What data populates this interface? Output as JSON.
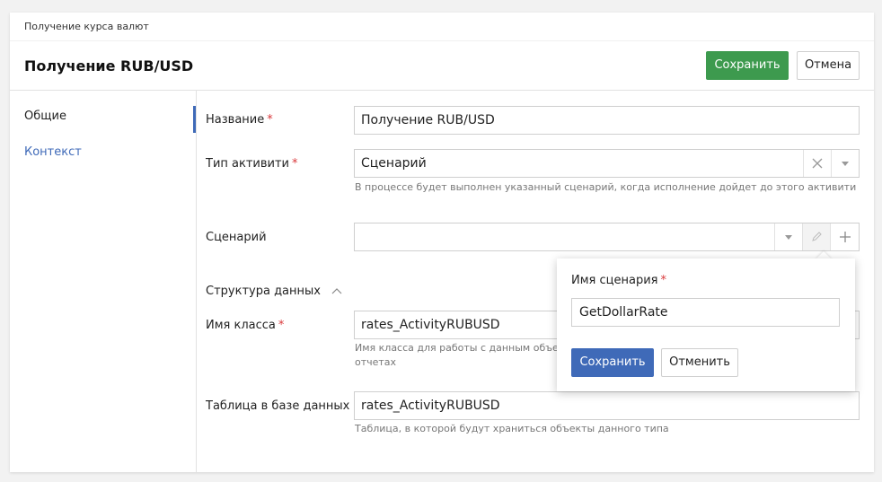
{
  "breadcrumb": "Получение курса валют",
  "header": {
    "title": "Получение RUB/USD",
    "save_label": "Сохранить",
    "cancel_label": "Отмена"
  },
  "sidebar": {
    "items": [
      {
        "label": "Общие"
      },
      {
        "label": "Контекст"
      }
    ]
  },
  "form": {
    "name_label": "Название",
    "name_value": "Получение RUB/USD",
    "type_label": "Тип активити",
    "type_value": "Сценарий",
    "type_hint": "В процессе будет выполнен указанный сценарий, когда исполнение дойдет до этого активити",
    "scenario_label": "Сценарий",
    "scenario_value": "",
    "structure_label": "Структура данных",
    "class_label": "Имя класса",
    "class_value": "rates_ActivityRUBUSD",
    "class_hint_line1": "Имя класса для работы с данным объек",
    "class_hint_line2": "отчетах",
    "table_label": "Таблица в базе данных",
    "table_value": "rates_ActivityRUBUSD",
    "table_hint": "Таблица, в которой будут храниться объекты данного типа"
  },
  "popup": {
    "label": "Имя сценария",
    "value": "GetDollarRate",
    "save_label": "Сохранить",
    "cancel_label": "Отменить"
  },
  "colors": {
    "accent_blue": "#3f6ab8",
    "save_green": "#3d9a4e",
    "required_red": "#d9383a"
  }
}
